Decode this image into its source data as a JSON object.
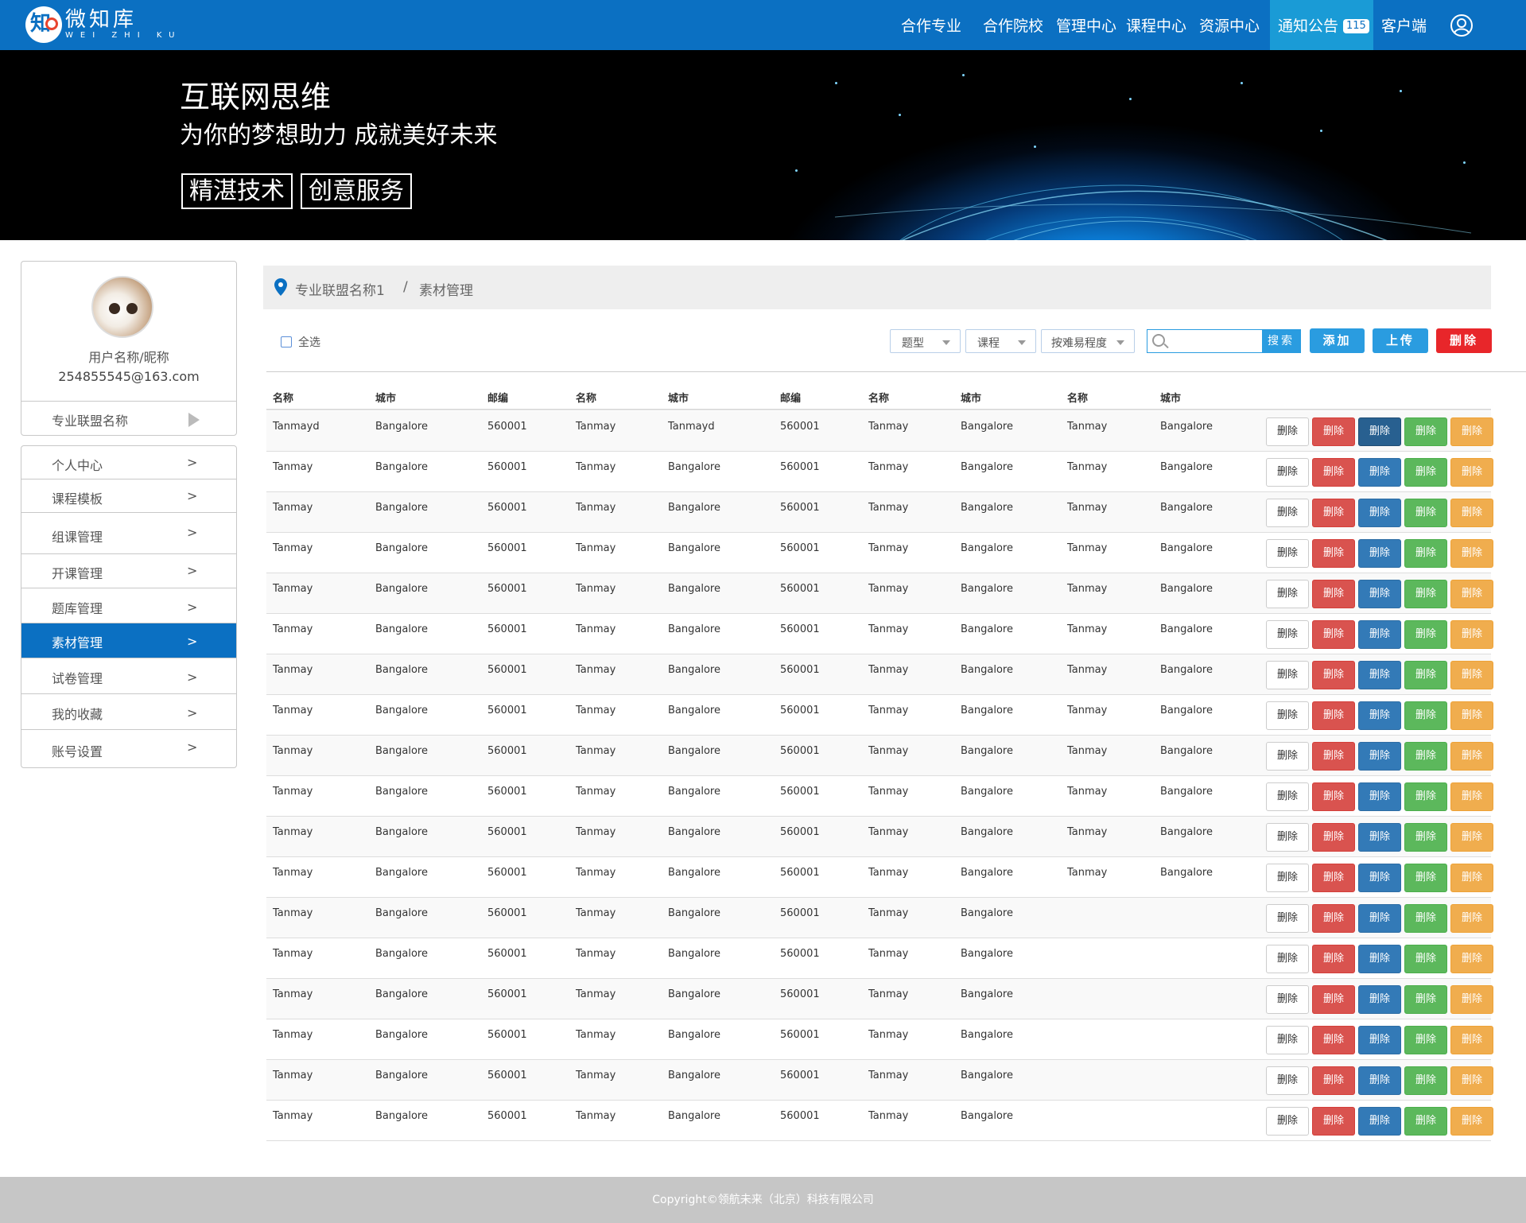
{
  "app": {
    "logo_cn": "微知库",
    "logo_en": "WEI ZHI KU",
    "logo_icon": "zhi-logo-icon"
  },
  "nav": {
    "items": [
      {
        "label": "合作专业"
      },
      {
        "label": "合作院校"
      },
      {
        "label": "管理中心"
      },
      {
        "label": "课程中心"
      },
      {
        "label": "资源中心"
      },
      {
        "label": "通知公告",
        "badge": "115"
      },
      {
        "label": "客户端"
      }
    ],
    "user_icon": "user-circle-icon"
  },
  "banner": {
    "title": "互联网思维",
    "subtitle": "为你的梦想助力  成就美好未来",
    "tags": [
      "精湛技术",
      "创意服务"
    ]
  },
  "profile": {
    "name": "用户名称/昵称",
    "email": "254855545@163.com",
    "league": "专业联盟名称"
  },
  "menu": [
    {
      "label": "个人中心",
      "arrow": ">"
    },
    {
      "label": "课程模板",
      "arrow": ">"
    },
    {
      "label": "组课管理",
      "arrow": ">"
    },
    {
      "label": "开课管理",
      "arrow": ">"
    },
    {
      "label": "题库管理",
      "arrow": ">"
    },
    {
      "label": "素材管理",
      "arrow": ">",
      "active": true
    },
    {
      "label": "试卷管理",
      "arrow": ">"
    },
    {
      "label": "我的收藏",
      "arrow": ">"
    },
    {
      "label": "账号设置",
      "arrow": ">"
    }
  ],
  "breadcrumb": {
    "icon": "location-pin-icon",
    "parent": "专业联盟名称1",
    "separator": "/",
    "current": "素材管理"
  },
  "toolbar": {
    "select_all": "全选",
    "filters": [
      "题型",
      "课程",
      "按难易程度"
    ],
    "search_placeholder": "",
    "search_button": "搜索",
    "add": "添加",
    "upload": "上传",
    "delete": "删除"
  },
  "colors": {
    "primary": "#0b70c2",
    "accent": "#2a9ce0",
    "danger": "#e8262a"
  },
  "table": {
    "headers": [
      "名称",
      "城市",
      "邮编",
      "名称",
      "城市",
      "邮编",
      "名称",
      "城市",
      "名称",
      "城市"
    ],
    "action_label": "删除",
    "rows": [
      [
        "Tanmayd",
        "Bangalore",
        "560001",
        "Tanmay",
        "Tanmayd",
        "560001",
        "Tanmay",
        "Bangalore",
        "Tanmay",
        "Bangalore"
      ],
      [
        "Tanmay",
        "Bangalore",
        "560001",
        "Tanmay",
        "Bangalore",
        "560001",
        "Tanmay",
        "Bangalore",
        "Tanmay",
        "Bangalore"
      ],
      [
        "Tanmay",
        "Bangalore",
        "560001",
        "Tanmay",
        "Bangalore",
        "560001",
        "Tanmay",
        "Bangalore",
        "Tanmay",
        "Bangalore"
      ],
      [
        "Tanmay",
        "Bangalore",
        "560001",
        "Tanmay",
        "Bangalore",
        "560001",
        "Tanmay",
        "Bangalore",
        "Tanmay",
        "Bangalore"
      ],
      [
        "Tanmay",
        "Bangalore",
        "560001",
        "Tanmay",
        "Bangalore",
        "560001",
        "Tanmay",
        "Bangalore",
        "Tanmay",
        "Bangalore"
      ],
      [
        "Tanmay",
        "Bangalore",
        "560001",
        "Tanmay",
        "Bangalore",
        "560001",
        "Tanmay",
        "Bangalore",
        "Tanmay",
        "Bangalore"
      ],
      [
        "Tanmay",
        "Bangalore",
        "560001",
        "Tanmay",
        "Bangalore",
        "560001",
        "Tanmay",
        "Bangalore",
        "Tanmay",
        "Bangalore"
      ],
      [
        "Tanmay",
        "Bangalore",
        "560001",
        "Tanmay",
        "Bangalore",
        "560001",
        "Tanmay",
        "Bangalore",
        "Tanmay",
        "Bangalore"
      ],
      [
        "Tanmay",
        "Bangalore",
        "560001",
        "Tanmay",
        "Bangalore",
        "560001",
        "Tanmay",
        "Bangalore",
        "Tanmay",
        "Bangalore"
      ],
      [
        "Tanmay",
        "Bangalore",
        "560001",
        "Tanmay",
        "Bangalore",
        "560001",
        "Tanmay",
        "Bangalore",
        "Tanmay",
        "Bangalore"
      ],
      [
        "Tanmay",
        "Bangalore",
        "560001",
        "Tanmay",
        "Bangalore",
        "560001",
        "Tanmay",
        "Bangalore",
        "Tanmay",
        "Bangalore"
      ],
      [
        "Tanmay",
        "Bangalore",
        "560001",
        "Tanmay",
        "Bangalore",
        "560001",
        "Tanmay",
        "Bangalore",
        "Tanmay",
        "Bangalore"
      ],
      [
        "Tanmay",
        "Bangalore",
        "560001",
        "Tanmay",
        "Bangalore",
        "560001",
        "Tanmay",
        "Bangalore",
        "",
        ""
      ],
      [
        "Tanmay",
        "Bangalore",
        "560001",
        "Tanmay",
        "Bangalore",
        "560001",
        "Tanmay",
        "Bangalore",
        "",
        ""
      ],
      [
        "Tanmay",
        "Bangalore",
        "560001",
        "Tanmay",
        "Bangalore",
        "560001",
        "Tanmay",
        "Bangalore",
        "",
        ""
      ],
      [
        "Tanmay",
        "Bangalore",
        "560001",
        "Tanmay",
        "Bangalore",
        "560001",
        "Tanmay",
        "Bangalore",
        "",
        ""
      ],
      [
        "Tanmay",
        "Bangalore",
        "560001",
        "Tanmay",
        "Bangalore",
        "560001",
        "Tanmay",
        "Bangalore",
        "",
        ""
      ],
      [
        "Tanmay",
        "Bangalore",
        "560001",
        "Tanmay",
        "Bangalore",
        "560001",
        "Tanmay",
        "Bangalore",
        "",
        ""
      ]
    ]
  },
  "footer": {
    "text": "Copyright©领航未来（北京）科技有限公司"
  }
}
